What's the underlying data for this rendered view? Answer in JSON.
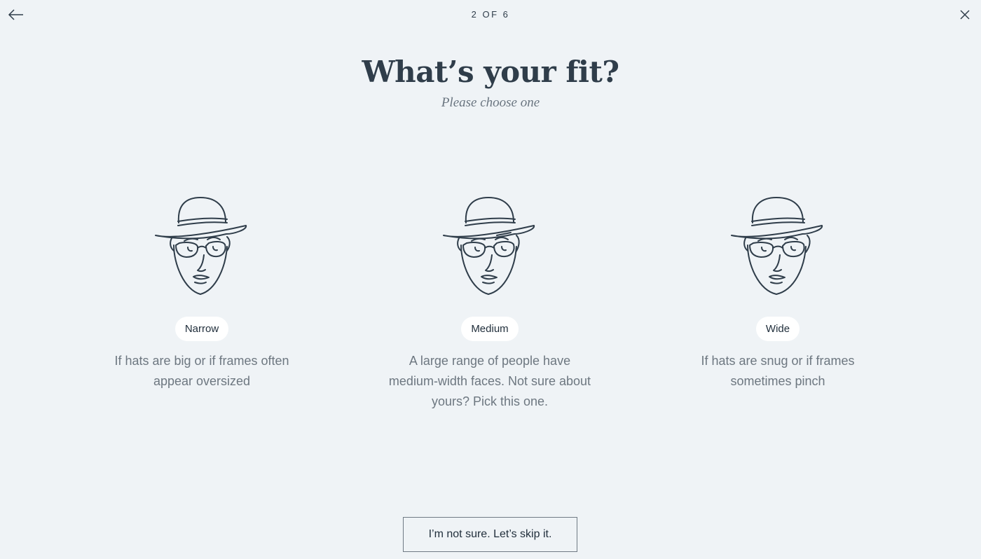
{
  "header": {
    "back_icon": "arrow-left-icon",
    "step_text": "2 OF 6",
    "close_icon": "close-icon"
  },
  "heading": {
    "title": "What’s your fit?",
    "subtitle": "Please choose one"
  },
  "options": [
    {
      "label": "Narrow",
      "description": "If hats are big or if frames often appear oversized",
      "icon": "narrow-face-icon"
    },
    {
      "label": "Medium",
      "description": "A large range of people have medium-width faces. Not sure about yours? Pick this one.",
      "icon": "medium-face-icon"
    },
    {
      "label": "Wide",
      "description": "If hats are snug or if frames sometimes pinch",
      "icon": "wide-face-icon"
    }
  ],
  "footer": {
    "skip_label": "I’m not sure. Let’s skip it."
  },
  "colors": {
    "background": "#eff3f6",
    "ink": "#2f3d4a",
    "pill": "#ffffff"
  }
}
